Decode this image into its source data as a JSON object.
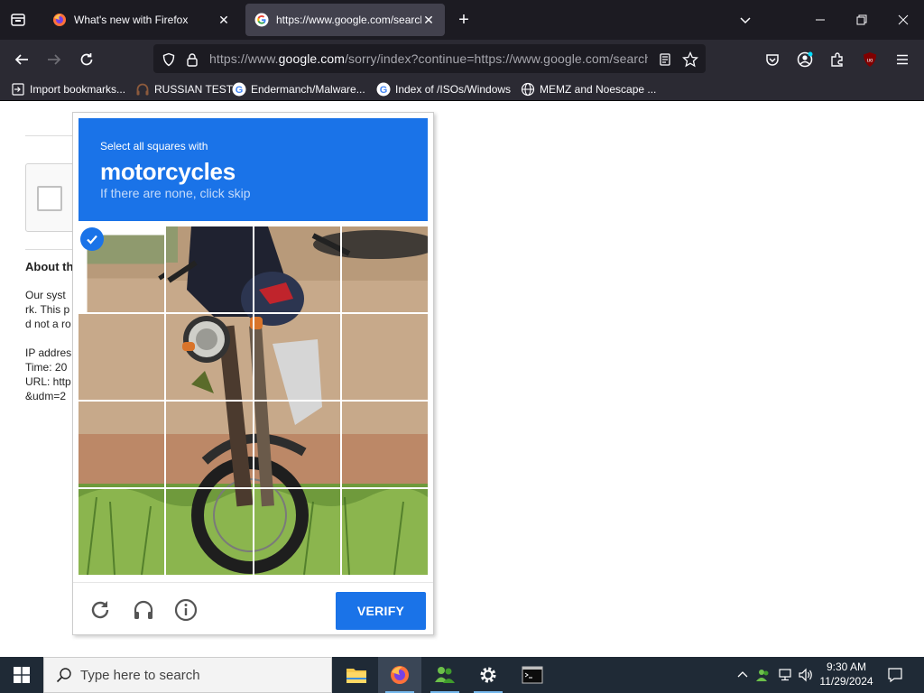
{
  "browser": {
    "tabs": [
      {
        "title": "What's new with Firefox",
        "active": false
      },
      {
        "title": "https://www.google.com/search",
        "active": true
      }
    ],
    "url": {
      "prefix": "https://www.",
      "domain": "google.com",
      "rest": "/sorry/index?continue=https://www.google.com/search?q"
    },
    "bookmarks": [
      {
        "label": "Import bookmarks...",
        "icon": "import-icon"
      },
      {
        "label": "RUSSIAN TEST",
        "icon": "headphones-icon"
      },
      {
        "label": "Endermanch/Malware...",
        "icon": "google-icon"
      },
      {
        "label": "Index of /ISOs/Windows",
        "icon": "google-icon"
      },
      {
        "label": "MEMZ and Noescape ...",
        "icon": "globe-icon"
      }
    ],
    "ublock_badge": "uo"
  },
  "page": {
    "about_heading": "About th",
    "lines": [
      "Our syst",
      "rk. This p",
      "d not a ro",
      "IP addres",
      "Time: 20",
      "URL: http",
      "&udm=2"
    ]
  },
  "captcha": {
    "instruction": "Select all squares with",
    "target": "motorcycles",
    "hint": "If there are none, click skip",
    "verify_label": "VERIFY",
    "rows": 4,
    "cols": 4,
    "selected_cells": [
      0
    ],
    "colors": {
      "accent": "#1a73e8"
    }
  },
  "taskbar": {
    "search_placeholder": "Type here to search",
    "time": "9:30 AM",
    "date": "11/29/2024"
  }
}
